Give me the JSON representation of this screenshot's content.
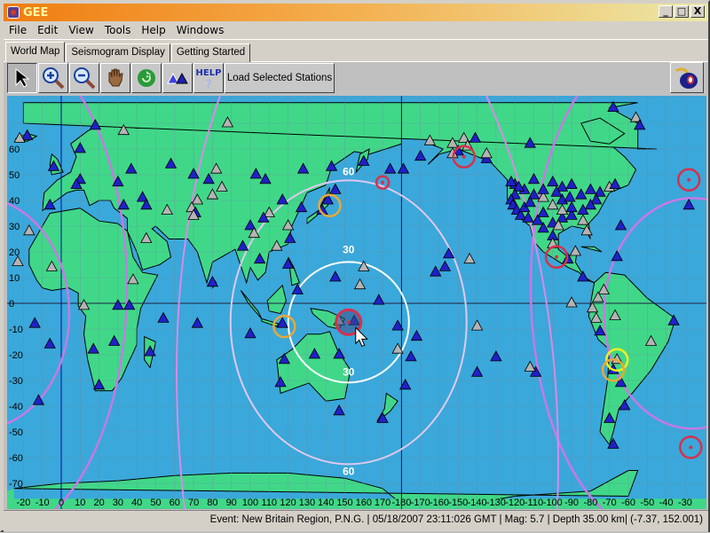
{
  "window": {
    "title": "GEE",
    "controls": [
      "_",
      "□",
      "X"
    ]
  },
  "menu": [
    "File",
    "Edit",
    "View",
    "Tools",
    "Help",
    "Windows"
  ],
  "tabs": [
    {
      "label": "World Map",
      "active": true
    },
    {
      "label": "Seismogram Display",
      "active": false
    },
    {
      "label": "Getting Started",
      "active": false
    }
  ],
  "toolbar": {
    "tools": [
      {
        "name": "select-arrow-icon",
        "pressed": true
      },
      {
        "name": "zoom-in-icon",
        "pressed": false
      },
      {
        "name": "zoom-out-icon",
        "pressed": false
      },
      {
        "name": "pan-hand-icon",
        "pressed": false
      },
      {
        "name": "refresh-icon",
        "pressed": false
      },
      {
        "name": "stations-icon",
        "pressed": false
      },
      {
        "name": "help-icon",
        "pressed": false
      }
    ],
    "help_label": "HELP",
    "load_label": "Load Selected Stations",
    "bomb_icon": "bomb-icon"
  },
  "map": {
    "colors": {
      "ocean": "#3aa8da",
      "land": "#40d888",
      "grid": "#6b8fa6",
      "station_active": "#2020c8",
      "station_inactive": "#b4b4b4",
      "distance_inner": "#ffffff",
      "distance_outer": "#e0c8f0",
      "great_circle": "#c878e6",
      "event_primary": "#d8304c",
      "event_orange": "#e8a838",
      "event_yellow": "#f0f020"
    },
    "lon_labels": [
      "-20",
      "-10",
      "0",
      "10",
      "20",
      "30",
      "40",
      "50",
      "60",
      "70",
      "80",
      "90",
      "100",
      "110",
      "120",
      "130",
      "140",
      "150",
      "160",
      "170",
      "-180",
      "-170",
      "-160",
      "-150",
      "-140",
      "-130",
      "-120",
      "-110",
      "-100",
      "-90",
      "-80",
      "-70",
      "-60",
      "-50",
      "-40",
      "-30"
    ],
    "lat_labels": [
      "60",
      "50",
      "40",
      "30",
      "20",
      "10",
      "0",
      "-10",
      "-20",
      "-30",
      "-40",
      "-50",
      "-60",
      "-70"
    ],
    "distance_labels": {
      "inner": "30",
      "outer": "60"
    },
    "event": {
      "lat": -7.37,
      "lon": 152.001
    },
    "events_other": [
      {
        "lat": 38,
        "lon": 142,
        "color": "orange"
      },
      {
        "lat": -9,
        "lon": 118,
        "color": "orange"
      },
      {
        "lat": 47,
        "lon": 170,
        "color": "primary"
      },
      {
        "lat": 57,
        "lon": -147,
        "color": "primary"
      },
      {
        "lat": 18,
        "lon": -98,
        "color": "primary"
      },
      {
        "lat": 48,
        "lon": -28,
        "color": "primary"
      },
      {
        "lat": -56,
        "lon": -27,
        "color": "primary"
      },
      {
        "lat": -22,
        "lon": -66,
        "color": "yellow"
      },
      {
        "lat": -26,
        "lon": -68,
        "color": "orange"
      }
    ],
    "stations": [
      {
        "lat": 65,
        "lon": -18,
        "a": 1
      },
      {
        "lat": 69,
        "lon": 18,
        "a": 1
      },
      {
        "lat": 67,
        "lon": 33,
        "a": 0
      },
      {
        "lat": 60,
        "lon": 10,
        "a": 1
      },
      {
        "lat": 53,
        "lon": -4,
        "a": 1
      },
      {
        "lat": 48,
        "lon": 10,
        "a": 1
      },
      {
        "lat": 46,
        "lon": 8,
        "a": 1
      },
      {
        "lat": 47,
        "lon": 30,
        "a": 1
      },
      {
        "lat": 52,
        "lon": 37,
        "a": 1
      },
      {
        "lat": 54,
        "lon": 58,
        "a": 1
      },
      {
        "lat": 50,
        "lon": 70,
        "a": 1
      },
      {
        "lat": 48,
        "lon": 78,
        "a": 1
      },
      {
        "lat": 52,
        "lon": 82,
        "a": 0
      },
      {
        "lat": 70,
        "lon": 88,
        "a": 0
      },
      {
        "lat": 45,
        "lon": 85,
        "a": 0
      },
      {
        "lat": 42,
        "lon": 80,
        "a": 0
      },
      {
        "lat": 40,
        "lon": 72,
        "a": 0
      },
      {
        "lat": 37,
        "lon": 69,
        "a": 0
      },
      {
        "lat": 35,
        "lon": 71,
        "a": 1
      },
      {
        "lat": 34,
        "lon": 70,
        "a": 0
      },
      {
        "lat": 41,
        "lon": 43,
        "a": 1
      },
      {
        "lat": 38,
        "lon": 33,
        "a": 1
      },
      {
        "lat": 38,
        "lon": 45,
        "a": 1
      },
      {
        "lat": 36,
        "lon": 56,
        "a": 0
      },
      {
        "lat": 25,
        "lon": 45,
        "a": 0
      },
      {
        "lat": 38,
        "lon": -6,
        "a": 1
      },
      {
        "lat": 38,
        "lon": -28,
        "a": 1
      },
      {
        "lat": 28,
        "lon": -17,
        "a": 0
      },
      {
        "lat": 16,
        "lon": -23,
        "a": 0
      },
      {
        "lat": 14,
        "lon": -5,
        "a": 0
      },
      {
        "lat": 9,
        "lon": 38,
        "a": 0
      },
      {
        "lat": -1,
        "lon": 30,
        "a": 1
      },
      {
        "lat": -1,
        "lon": 36,
        "a": 1
      },
      {
        "lat": -1,
        "lon": 12,
        "a": 0
      },
      {
        "lat": -6,
        "lon": 54,
        "a": 1
      },
      {
        "lat": -8,
        "lon": 72,
        "a": 1
      },
      {
        "lat": -15,
        "lon": 28,
        "a": 1
      },
      {
        "lat": -18,
        "lon": 17,
        "a": 1
      },
      {
        "lat": -19,
        "lon": 47,
        "a": 1
      },
      {
        "lat": -32,
        "lon": 20,
        "a": 1
      },
      {
        "lat": -8,
        "lon": -14,
        "a": 1
      },
      {
        "lat": -16,
        "lon": -6,
        "a": 1
      },
      {
        "lat": -38,
        "lon": -12,
        "a": 1
      },
      {
        "lat": 8,
        "lon": 80,
        "a": 1
      },
      {
        "lat": -12,
        "lon": 100,
        "a": 1
      },
      {
        "lat": 30,
        "lon": 100,
        "a": 1
      },
      {
        "lat": 22,
        "lon": 96,
        "a": 1
      },
      {
        "lat": 27,
        "lon": 102,
        "a": 0
      },
      {
        "lat": 50,
        "lon": 103,
        "a": 1
      },
      {
        "lat": 48,
        "lon": 108,
        "a": 1
      },
      {
        "lat": 52,
        "lon": 128,
        "a": 1
      },
      {
        "lat": 55,
        "lon": 160,
        "a": 1
      },
      {
        "lat": 53,
        "lon": 143,
        "a": 1
      },
      {
        "lat": 44,
        "lon": 145,
        "a": 1
      },
      {
        "lat": 40,
        "lon": 141,
        "a": 1
      },
      {
        "lat": 36,
        "lon": 138,
        "a": 1
      },
      {
        "lat": 37,
        "lon": 127,
        "a": 1
      },
      {
        "lat": 40,
        "lon": 117,
        "a": 1
      },
      {
        "lat": 35,
        "lon": 110,
        "a": 0
      },
      {
        "lat": 33,
        "lon": 107,
        "a": 1
      },
      {
        "lat": 30,
        "lon": 120,
        "a": 0
      },
      {
        "lat": 25,
        "lon": 121,
        "a": 1
      },
      {
        "lat": 22,
        "lon": 114,
        "a": 0
      },
      {
        "lat": 17,
        "lon": 105,
        "a": 1
      },
      {
        "lat": 15,
        "lon": 120,
        "a": 1
      },
      {
        "lat": 5,
        "lon": 125,
        "a": 1
      },
      {
        "lat": -8,
        "lon": 117,
        "a": 1
      },
      {
        "lat": -20,
        "lon": 134,
        "a": 1
      },
      {
        "lat": -22,
        "lon": 118,
        "a": 1
      },
      {
        "lat": -31,
        "lon": 116,
        "a": 1
      },
      {
        "lat": -20,
        "lon": 147,
        "a": 1
      },
      {
        "lat": -42,
        "lon": 147,
        "a": 1
      },
      {
        "lat": -45,
        "lon": 170,
        "a": 1
      },
      {
        "lat": 10,
        "lon": 145,
        "a": 1
      },
      {
        "lat": 14,
        "lon": 160,
        "a": 0
      },
      {
        "lat": 7,
        "lon": 158,
        "a": 0
      },
      {
        "lat": -7,
        "lon": 147,
        "a": 0
      },
      {
        "lat": -7,
        "lon": 155,
        "a": 1
      },
      {
        "lat": 1,
        "lon": 168,
        "a": 1
      },
      {
        "lat": -9,
        "lon": 178,
        "a": 1
      },
      {
        "lat": -13,
        "lon": -172,
        "a": 1
      },
      {
        "lat": -18,
        "lon": 178,
        "a": 0
      },
      {
        "lat": -21,
        "lon": -175,
        "a": 1
      },
      {
        "lat": -32,
        "lon": -178,
        "a": 1
      },
      {
        "lat": 19,
        "lon": -155,
        "a": 1
      },
      {
        "lat": 12,
        "lon": -162,
        "a": 1
      },
      {
        "lat": 17,
        "lon": -144,
        "a": 0
      },
      {
        "lat": 14,
        "lon": -157,
        "a": 1
      },
      {
        "lat": -27,
        "lon": -109,
        "a": 1
      },
      {
        "lat": -21,
        "lon": -130,
        "a": 1
      },
      {
        "lat": -9,
        "lon": -140,
        "a": 0
      },
      {
        "lat": 52,
        "lon": 174,
        "a": 1
      },
      {
        "lat": 64,
        "lon": -147,
        "a": 0
      },
      {
        "lat": 61,
        "lon": -145,
        "a": 0
      },
      {
        "lat": 62,
        "lon": -153,
        "a": 0
      },
      {
        "lat": 63,
        "lon": -165,
        "a": 0
      },
      {
        "lat": 59,
        "lon": -150,
        "a": 1
      },
      {
        "lat": 58,
        "lon": -153,
        "a": 0
      },
      {
        "lat": 56,
        "lon": -135,
        "a": 1
      },
      {
        "lat": 64,
        "lon": -141,
        "a": 1
      },
      {
        "lat": 57,
        "lon": -170,
        "a": 1
      },
      {
        "lat": 58,
        "lon": -135,
        "a": 0
      },
      {
        "lat": 52,
        "lon": -179,
        "a": 1
      },
      {
        "lat": 62,
        "lon": -112,
        "a": 1
      },
      {
        "lat": 47,
        "lon": -100,
        "a": 1
      },
      {
        "lat": 45,
        "lon": -95,
        "a": 1
      },
      {
        "lat": 46,
        "lon": -90,
        "a": 1
      },
      {
        "lat": 42,
        "lon": -85,
        "a": 1
      },
      {
        "lat": 44,
        "lon": -80,
        "a": 1
      },
      {
        "lat": 43,
        "lon": -75,
        "a": 1
      },
      {
        "lat": 45,
        "lon": -70,
        "a": 0
      },
      {
        "lat": 46,
        "lon": -67,
        "a": 1
      },
      {
        "lat": 40,
        "lon": -77,
        "a": 1
      },
      {
        "lat": 38,
        "lon": -80,
        "a": 1
      },
      {
        "lat": 36,
        "lon": -84,
        "a": 1
      },
      {
        "lat": 34,
        "lon": -90,
        "a": 1
      },
      {
        "lat": 33,
        "lon": -95,
        "a": 1
      },
      {
        "lat": 31,
        "lon": -100,
        "a": 1
      },
      {
        "lat": 29,
        "lon": -105,
        "a": 1
      },
      {
        "lat": 38,
        "lon": -100,
        "a": 0
      },
      {
        "lat": 40,
        "lon": -95,
        "a": 1
      },
      {
        "lat": 35,
        "lon": -105,
        "a": 1
      },
      {
        "lat": 32,
        "lon": -84,
        "a": 0
      },
      {
        "lat": 28,
        "lon": -82,
        "a": 0
      },
      {
        "lat": 42,
        "lon": -110,
        "a": 1
      },
      {
        "lat": 44,
        "lon": -115,
        "a": 1
      },
      {
        "lat": 46,
        "lon": -120,
        "a": 1
      },
      {
        "lat": 47,
        "lon": -122,
        "a": 1
      },
      {
        "lat": 45,
        "lon": -118,
        "a": 1
      },
      {
        "lat": 42,
        "lon": -120,
        "a": 1
      },
      {
        "lat": 40,
        "lon": -122,
        "a": 1
      },
      {
        "lat": 38,
        "lon": -121,
        "a": 1
      },
      {
        "lat": 36,
        "lon": -119,
        "a": 1
      },
      {
        "lat": 34,
        "lon": -117,
        "a": 1
      },
      {
        "lat": 37,
        "lon": -115,
        "a": 1
      },
      {
        "lat": 39,
        "lon": -112,
        "a": 1
      },
      {
        "lat": 41,
        "lon": -105,
        "a": 0
      },
      {
        "lat": 44,
        "lon": -105,
        "a": 1
      },
      {
        "lat": 48,
        "lon": -110,
        "a": 1
      },
      {
        "lat": 43,
        "lon": -98,
        "a": 1
      },
      {
        "lat": 37,
        "lon": -90,
        "a": 1
      },
      {
        "lat": 41,
        "lon": -91,
        "a": 1
      },
      {
        "lat": 36,
        "lon": -95,
        "a": 0
      },
      {
        "lat": 33,
        "lon": -113,
        "a": 1
      },
      {
        "lat": 32,
        "lon": -108,
        "a": 1
      },
      {
        "lat": 30,
        "lon": -97,
        "a": 0
      },
      {
        "lat": 26,
        "lon": -100,
        "a": 1
      },
      {
        "lat": 23,
        "lon": -100,
        "a": 0
      },
      {
        "lat": 20,
        "lon": -88,
        "a": 0
      },
      {
        "lat": 17,
        "lon": -92,
        "a": 1
      },
      {
        "lat": 10,
        "lon": -84,
        "a": 1
      },
      {
        "lat": 30,
        "lon": -64,
        "a": 1
      },
      {
        "lat": 18,
        "lon": -66,
        "a": 1
      },
      {
        "lat": 5,
        "lon": -73,
        "a": 0
      },
      {
        "lat": 2,
        "lon": -76,
        "a": 0
      },
      {
        "lat": -2,
        "lon": -79,
        "a": 0
      },
      {
        "lat": 0,
        "lon": -90,
        "a": 0
      },
      {
        "lat": -6,
        "lon": -77,
        "a": 0
      },
      {
        "lat": -5,
        "lon": -67,
        "a": 0
      },
      {
        "lat": -11,
        "lon": -75,
        "a": 1
      },
      {
        "lat": -7,
        "lon": -36,
        "a": 1
      },
      {
        "lat": -15,
        "lon": -48,
        "a": 0
      },
      {
        "lat": -22,
        "lon": -66,
        "a": 0
      },
      {
        "lat": -26,
        "lon": -68,
        "a": 1
      },
      {
        "lat": -31,
        "lon": -64,
        "a": 1
      },
      {
        "lat": -45,
        "lon": -70,
        "a": 1
      },
      {
        "lat": -40,
        "lon": -62,
        "a": 1
      },
      {
        "lat": -55,
        "lon": -68,
        "a": 1
      },
      {
        "lat": -25,
        "lon": -112,
        "a": 0
      },
      {
        "lat": -27,
        "lon": -140,
        "a": 1
      },
      {
        "lat": 72,
        "lon": -56,
        "a": 0
      },
      {
        "lat": 69,
        "lon": -54,
        "a": 1
      },
      {
        "lat": 76,
        "lon": -68,
        "a": 1
      },
      {
        "lat": 64,
        "lon": -22,
        "a": 0
      }
    ]
  },
  "status": {
    "text": "Event: New Britain Region, P.N.G. | 05/18/2007 23:11:026 GMT | Mag: 5.7 | Depth 35.00 km| (-7.37, 152.001)"
  }
}
